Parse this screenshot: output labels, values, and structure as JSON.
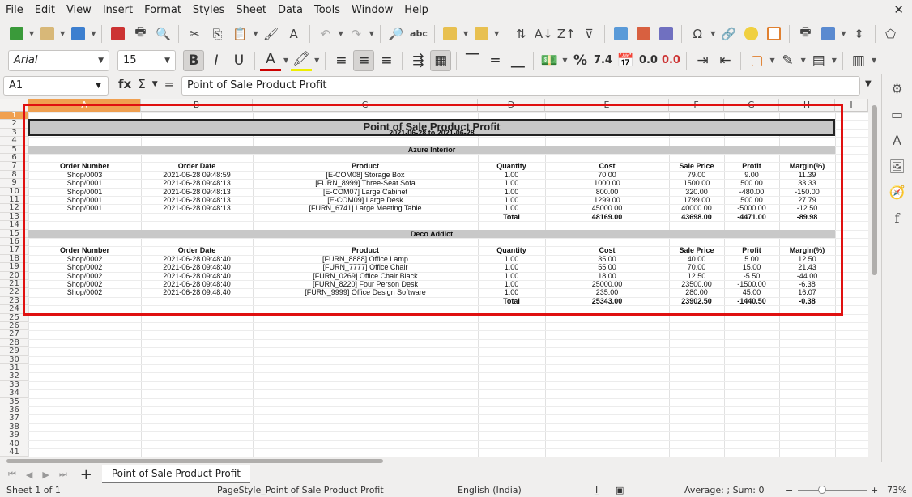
{
  "menubar": {
    "items": [
      "File",
      "Edit",
      "View",
      "Insert",
      "Format",
      "Styles",
      "Sheet",
      "Data",
      "Tools",
      "Window",
      "Help"
    ]
  },
  "font": {
    "name": "Arial",
    "size": "15"
  },
  "toolbar2": {
    "percent": "%",
    "number_fmt": "7.4",
    "add_decimal": "0.0",
    "del_decimal": "0.0"
  },
  "formula": {
    "cell_ref": "A1",
    "content": "Point of Sale Product Profit",
    "fx": "fx",
    "sigma": "Σ",
    "equals": "="
  },
  "columns": [
    "A",
    "B",
    "C",
    "D",
    "E",
    "F",
    "G",
    "H",
    "I"
  ],
  "rows": [
    "1",
    "2",
    "3",
    "4",
    "5",
    "6",
    "7",
    "8",
    "9",
    "10",
    "11",
    "12",
    "13",
    "14",
    "15",
    "16",
    "17",
    "18",
    "19",
    "20",
    "21",
    "22",
    "23",
    "24",
    "25",
    "26",
    "27",
    "28",
    "29",
    "30",
    "31",
    "32",
    "33",
    "34",
    "35",
    "36",
    "37",
    "38",
    "39",
    "40",
    "41"
  ],
  "report": {
    "title": "Point of Sale Product Profit",
    "date_range": "2021-06-28 to 2021-06-28",
    "headers": [
      "Order Number",
      "Order Date",
      "Product",
      "Quantity",
      "Cost",
      "Sale Price",
      "Profit",
      "Margin(%)"
    ],
    "sections": [
      {
        "customer": "Azure Interior",
        "rows": [
          [
            "Shop/0003",
            "2021-06-28 09:48:59",
            "[E-COM08] Storage Box",
            "1.00",
            "70.00",
            "79.00",
            "9.00",
            "11.39"
          ],
          [
            "Shop/0001",
            "2021-06-28 09:48:13",
            "[FURN_8999] Three-Seat Sofa",
            "1.00",
            "1000.00",
            "1500.00",
            "500.00",
            "33.33"
          ],
          [
            "Shop/0001",
            "2021-06-28 09:48:13",
            "[E-COM07] Large Cabinet",
            "1.00",
            "800.00",
            "320.00",
            "-480.00",
            "-150.00"
          ],
          [
            "Shop/0001",
            "2021-06-28 09:48:13",
            "[E-COM09] Large Desk",
            "1.00",
            "1299.00",
            "1799.00",
            "500.00",
            "27.79"
          ],
          [
            "Shop/0001",
            "2021-06-28 09:48:13",
            "[FURN_6741] Large Meeting Table",
            "1.00",
            "45000.00",
            "40000.00",
            "-5000.00",
            "-12.50"
          ]
        ],
        "total": {
          "label": "Total",
          "cost": "48169.00",
          "sale": "43698.00",
          "profit": "-4471.00",
          "margin": "-89.98"
        }
      },
      {
        "customer": "Deco Addict",
        "rows": [
          [
            "Shop/0002",
            "2021-06-28 09:48:40",
            "[FURN_8888] Office Lamp",
            "1.00",
            "35.00",
            "40.00",
            "5.00",
            "12.50"
          ],
          [
            "Shop/0002",
            "2021-06-28 09:48:40",
            "[FURN_7777] Office Chair",
            "1.00",
            "55.00",
            "70.00",
            "15.00",
            "21.43"
          ],
          [
            "Shop/0002",
            "2021-06-28 09:48:40",
            "[FURN_0269] Office Chair Black",
            "1.00",
            "18.00",
            "12.50",
            "-5.50",
            "-44.00"
          ],
          [
            "Shop/0002",
            "2021-06-28 09:48:40",
            "[FURN_8220] Four Person Desk",
            "1.00",
            "25000.00",
            "23500.00",
            "-1500.00",
            "-6.38"
          ],
          [
            "Shop/0002",
            "2021-06-28 09:48:40",
            "[FURN_9999] Office Design Software",
            "1.00",
            "235.00",
            "280.00",
            "45.00",
            "16.07"
          ]
        ],
        "total": {
          "label": "Total",
          "cost": "25343.00",
          "sale": "23902.50",
          "profit": "-1440.50",
          "margin": "-0.38"
        }
      }
    ]
  },
  "tabs": {
    "sheet_name": "Point of Sale Product Profit"
  },
  "status": {
    "sheet": "Sheet 1 of 1",
    "page_style": "PageStyle_Point of Sale Product Profit",
    "language": "English (India)",
    "summary": "Average: ; Sum: 0",
    "zoom": "73%",
    "zoom_minus": "−",
    "zoom_plus": "+"
  },
  "colors": {
    "selection": "#f0a050",
    "highlight": "#e01010",
    "band": "#c8c8c8"
  }
}
